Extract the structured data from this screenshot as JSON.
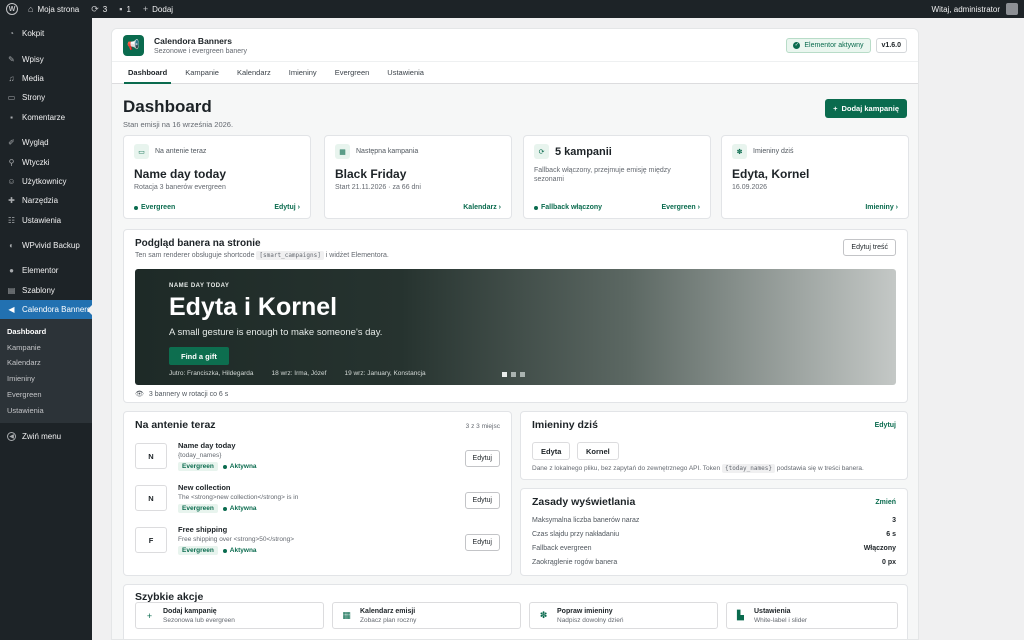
{
  "adminbar": {
    "site_name": "Moja strona",
    "updates_count": "3",
    "comments_count": "1",
    "add_new": "Dodaj",
    "greeting": "Witaj, administrator"
  },
  "sidebar": {
    "items": [
      {
        "label": "Kokpit",
        "icon": "dashboard-icon"
      },
      {
        "label": "Wpisy",
        "icon": "pin-icon"
      },
      {
        "label": "Media",
        "icon": "media-icon"
      },
      {
        "label": "Strony",
        "icon": "page-icon"
      },
      {
        "label": "Komentarze",
        "icon": "comment-icon"
      },
      {
        "label": "Wygląd",
        "icon": "brush-icon"
      },
      {
        "label": "Wtyczki",
        "icon": "plugin-icon"
      },
      {
        "label": "Użytkownicy",
        "icon": "users-icon"
      },
      {
        "label": "Narzędzia",
        "icon": "wrench-icon"
      },
      {
        "label": "Ustawienia",
        "icon": "settings-icon"
      },
      {
        "label": "WPvivid Backup",
        "icon": "backup-icon"
      },
      {
        "label": "Elementor",
        "icon": "elementor-icon"
      },
      {
        "label": "Szablony",
        "icon": "templates-icon"
      },
      {
        "label": "Calendora Banners",
        "icon": "megaphone-icon"
      }
    ],
    "submenu": [
      "Dashboard",
      "Kampanie",
      "Kalendarz",
      "Imieniny",
      "Evergreen",
      "Ustawienia"
    ],
    "collapse": "Zwiń menu"
  },
  "plugin": {
    "name": "Calendora Banners",
    "tagline": "Sezonowe i evergreen banery",
    "status_badge": "Elementor aktywny",
    "version": "v1.6.0",
    "tabs": [
      "Dashboard",
      "Kampanie",
      "Kalendarz",
      "Imieniny",
      "Evergreen",
      "Ustawienia"
    ]
  },
  "dashboard": {
    "title": "Dashboard",
    "subtitle": "Stan emisji na 16 września 2026.",
    "add_campaign": "Dodaj kampanię"
  },
  "stats": [
    {
      "label": "Na antenie teraz",
      "title": "Name day today",
      "sub": "Rotacja 3 banerów evergreen",
      "status": "Evergreen",
      "link": "Edytuj",
      "icon": "monitor-icon"
    },
    {
      "label": "Następna kampania",
      "title": "Black Friday",
      "sub": "Start 21.11.2026 · za 66 dni",
      "status": "",
      "link": "Kalendarz",
      "icon": "calendar-icon"
    },
    {
      "label": "",
      "title": "5 kampanii",
      "sub": "Fallback włączony, przejmuje emisję między sezonami",
      "status": "Fallback włączony",
      "link": "Evergreen",
      "icon": "refresh-icon"
    },
    {
      "label": "Imieniny dziś",
      "title": "Edyta, Kornel",
      "sub": "16.09.2026",
      "status": "",
      "link": "Imieniny",
      "icon": "gift-icon"
    }
  ],
  "preview": {
    "title": "Podgląd banera na stronie",
    "sub_before": "Ten sam renderer obsługuje shortcode",
    "shortcode": "[smart_campaigns]",
    "sub_after": "i widżet Elementora.",
    "edit_content": "Edytuj treść",
    "banner": {
      "eyebrow": "NAME DAY TODAY",
      "title": "Edyta i Kornel",
      "text": "A small gesture is enough to make someone's day.",
      "button": "Find a gift",
      "footer": [
        "Jutro: Franciszka, Hildegarda",
        "18 wrz: Irma, Józef",
        "19 wrz: January, Konstancja"
      ]
    },
    "rotation": "3 bannery w rotacji co 6 s"
  },
  "on_air": {
    "title": "Na antenie teraz",
    "count": "3 z 3 miejsc",
    "rows": [
      {
        "avatar": "N",
        "name": "Name day today",
        "desc": "{today_names}",
        "tag": "Evergreen",
        "status": "Aktywna",
        "action": "Edytuj"
      },
      {
        "avatar": "N",
        "name": "New collection",
        "desc": "The <strong>new collection</strong> is in",
        "tag": "Evergreen",
        "status": "Aktywna",
        "action": "Edytuj"
      },
      {
        "avatar": "F",
        "name": "Free shipping",
        "desc": "Free shipping over <strong>50</strong>",
        "tag": "Evergreen",
        "status": "Aktywna",
        "action": "Edytuj"
      }
    ]
  },
  "names_today": {
    "title": "Imieniny dziś",
    "edit": "Edytuj",
    "names": [
      "Edyta",
      "Kornel"
    ],
    "note_before": "Dane z lokalnego pliku, bez zapytań do zewnętrznego API. Token",
    "token": "{today_names}",
    "note_after": "podstawia się w treści banera."
  },
  "rules": {
    "title": "Zasady wyświetlania",
    "edit": "Zmień",
    "rows": [
      {
        "label": "Maksymalna liczba banerów naraz",
        "value": "3"
      },
      {
        "label": "Czas slajdu przy nakładaniu",
        "value": "6 s"
      },
      {
        "label": "Fallback evergreen",
        "value": "Włączony"
      },
      {
        "label": "Zaokrąglenie rogów banera",
        "value": "0 px"
      }
    ]
  },
  "quick_actions": {
    "title": "Szybkie akcje",
    "items": [
      {
        "title": "Dodaj kampanię",
        "sub": "Sezonowa lub evergreen",
        "icon": "plus-icon"
      },
      {
        "title": "Kalendarz emisji",
        "sub": "Zobacz plan roczny",
        "icon": "calendar-icon"
      },
      {
        "title": "Popraw imieniny",
        "sub": "Nadpisz dowolny dzień",
        "icon": "gift-icon"
      },
      {
        "title": "Ustawienia",
        "sub": "White-label i slider",
        "icon": "settings-icon"
      }
    ]
  },
  "colors": {
    "brand": "#0a6b4e",
    "wp_blue": "#2271b1",
    "adminbar": "#1d2327"
  }
}
